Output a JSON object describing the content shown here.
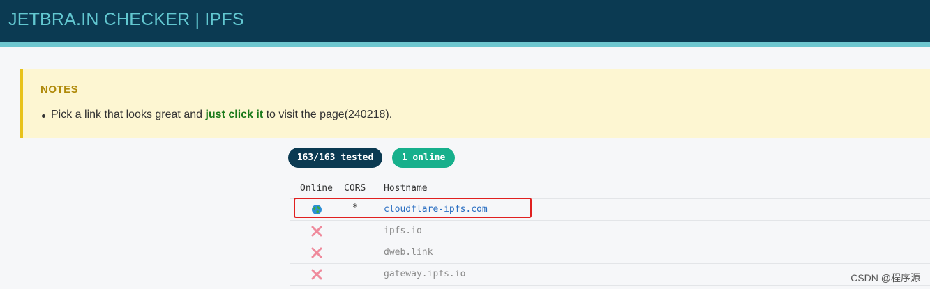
{
  "header": {
    "title": "JETBRA.IN CHECKER | IPFS",
    "accent_color": "#62c7d0",
    "background_color": "#0b3a52"
  },
  "notes": {
    "title": "NOTES",
    "text_before": "Pick a link that looks great and ",
    "highlight": "just click it",
    "text_after": " to visit the page(240218)."
  },
  "badges": {
    "tested": "163/163 tested",
    "online": "1 online"
  },
  "table": {
    "columns": [
      "Online",
      "CORS",
      "Hostname"
    ],
    "rows": [
      {
        "status": "online",
        "status_icon": "globe-icon",
        "cors": "*",
        "hostname": "cloudflare-ipfs.com"
      },
      {
        "status": "offline",
        "status_icon": "cross-icon",
        "cors": "",
        "hostname": "ipfs.io"
      },
      {
        "status": "offline",
        "status_icon": "cross-icon",
        "cors": "",
        "hostname": "dweb.link"
      },
      {
        "status": "offline",
        "status_icon": "cross-icon",
        "cors": "",
        "hostname": "gateway.ipfs.io"
      }
    ]
  },
  "watermark": "CSDN @程序源"
}
